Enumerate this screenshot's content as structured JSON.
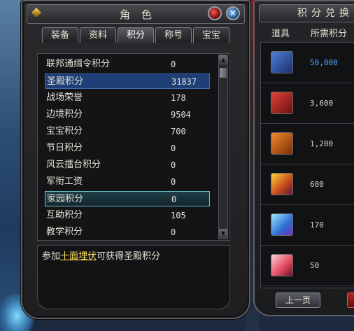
{
  "character_panel": {
    "title": "角色",
    "tabs": [
      "装备",
      "资料",
      "积分",
      "称号",
      "宝宝"
    ],
    "active_tab": "积分",
    "rows": [
      {
        "label": "联邦通缉令积分",
        "value": "0"
      },
      {
        "label": "圣殿积分",
        "value": "31837"
      },
      {
        "label": "战场荣誉",
        "value": "178"
      },
      {
        "label": "边境积分",
        "value": "9504"
      },
      {
        "label": "宝宝积分",
        "value": "700"
      },
      {
        "label": "节日积分",
        "value": "0"
      },
      {
        "label": "风云擂台积分",
        "value": "0"
      },
      {
        "label": "军衔工资",
        "value": "0"
      },
      {
        "label": "家园积分",
        "value": "0"
      },
      {
        "label": "互助积分",
        "value": "105"
      },
      {
        "label": "教学积分",
        "value": "0"
      }
    ],
    "selected_row_blue": "圣殿积分",
    "selected_row_teal": "家园积分",
    "description": {
      "prefix": "参加",
      "link": "十面埋伏",
      "suffix": "可获得圣殿积分"
    }
  },
  "exchange_panel": {
    "title": "积分兑换",
    "headers": [
      "道具",
      "所需积分"
    ],
    "items": [
      {
        "icon": "blue-chest-icon",
        "price": "50,000",
        "highlight": true
      },
      {
        "icon": "red-chest-icon",
        "price": "3,600",
        "highlight": false
      },
      {
        "icon": "orange-chest-icon",
        "price": "1,200",
        "highlight": false
      },
      {
        "icon": "gold-crystal-icon",
        "price": "600",
        "highlight": false
      },
      {
        "icon": "blue-crystal-icon",
        "price": "170",
        "highlight": false
      },
      {
        "icon": "red-crystal-icon",
        "price": "50",
        "highlight": false
      }
    ],
    "prev_button": "上一页"
  },
  "colors": {
    "link": "#ffe05a",
    "highlight_price": "#4fa3ff",
    "selected_blue": "#1f3f76",
    "selected_teal_border": "#6fc2d4"
  }
}
